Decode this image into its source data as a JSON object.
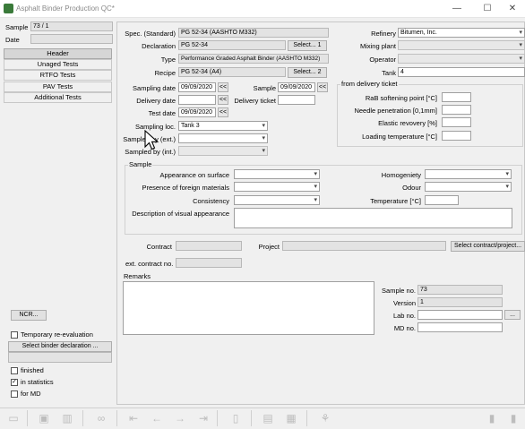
{
  "window": {
    "title": "Asphalt Binder Production QC*",
    "minimize": "—",
    "maximize": "☐",
    "close": "✕"
  },
  "sidebar": {
    "sample_label": "Sample",
    "sample_value": "73 / 1",
    "date_label": "Date",
    "date_value": "",
    "tabs": [
      {
        "label": "Header"
      },
      {
        "label": "Unaged Tests"
      },
      {
        "label": "RTFO Tests"
      },
      {
        "label": "PAV Tests"
      },
      {
        "label": "Additional Tests"
      }
    ],
    "ncr_button": "NCR...",
    "temporary_reevaluation": "Temporary re-evaluation",
    "select_binder_button": "Select binder declaration ...",
    "finished": "finished",
    "in_statistics": "in statistics",
    "for_md": "for MD",
    "temporary_checked": false,
    "finished_checked": false,
    "in_statistics_checked": true,
    "for_md_checked": false
  },
  "header": {
    "spec_label": "Spec. (Standard)",
    "spec_value": "PG 52-34 (AASHTO M332)",
    "declaration_label": "Declaration",
    "declaration_value": "PG 52-34",
    "select1_button": "Select... 1",
    "type_label": "Type",
    "type_value": "Performance Graded Asphalt Binder (AASHTO M332)",
    "recipe_label": "Recipe",
    "recipe_value": "PG 52-34 (A4)",
    "select2_button": "Select... 2",
    "sampling_date_label": "Sampling date",
    "sampling_date_value": "09/09/2020",
    "sample_label": "Sample",
    "sample_value": "09/09/2020",
    "delivery_date_label": "Delivery date",
    "delivery_date_value": "",
    "delivery_ticket_label": "Delivery ticket",
    "delivery_ticket_value": "",
    "test_date_label": "Test date",
    "test_date_value": "09/09/2020",
    "sampling_loc_label": "Sampling loc.",
    "sampling_loc_value": "Tank 3",
    "sampled_by_ext_label": "Sampled by (ext.)",
    "sampled_by_ext_value": "",
    "sampled_by_int_label": "Sampled by (int.)",
    "sampled_by_int_value": "",
    "refinery_label": "Refinery",
    "refinery_value": "Bitumen, Inc.",
    "mixing_plant_label": "Mixing plant",
    "mixing_plant_value": "",
    "operator_label": "Operator",
    "operator_value": "",
    "tank_label": "Tank",
    "tank_value": "4",
    "delivery_ticket_group": "from delivery ticket",
    "rab_label": "RaB softening point [°C]",
    "needle_label": "Needle penetration [0,1mm]",
    "elastic_label": "Elastic revovery [%]",
    "loading_label": "Loading temperature [°C]",
    "rab_value": "",
    "needle_value": "",
    "elastic_value": "",
    "loading_value": "",
    "date_picker_glyph": "<<"
  },
  "sample_group": {
    "title": "Sample",
    "appearance_label": "Appearance on surface",
    "appearance_value": "",
    "foreign_label": "Presence of foreign materials",
    "foreign_value": "",
    "consistency_label": "Consistency",
    "consistency_value": "",
    "description_label": "Description of visual appearance",
    "description_value": "",
    "homogeneity_label": "Homogeniety",
    "homogeneity_value": "",
    "odour_label": "Odour",
    "odour_value": "",
    "temperature_label": "Temperature [°C]",
    "temperature_value": ""
  },
  "contract": {
    "contract_label": "Contract",
    "contract_value": "",
    "project_label": "Project",
    "project_value": "",
    "select_contract_button": "Select contract/project...",
    "ext_contract_label": "ext. contract no.",
    "ext_contract_value": ""
  },
  "remarks": {
    "label": "Remarks",
    "value": "",
    "sample_no_label": "Sample no.",
    "sample_no_value": "73",
    "version_label": "Version",
    "version_value": "1",
    "lab_no_label": "Lab no.",
    "lab_no_value": "",
    "lab_no_button": "...",
    "md_no_label": "MD no.",
    "md_no_value": ""
  },
  "toolbar": {
    "icons": [
      "new-record-icon",
      "save-icon",
      "delete-icon",
      "binoculars-icon",
      "first-record-icon",
      "previous-record-icon",
      "next-record-icon",
      "last-record-icon",
      "door-icon",
      "report-icon",
      "print-icon",
      "stamp-icon",
      "exit-icon",
      "close-window-icon"
    ]
  },
  "colors": {
    "window_bg": "#f0f0f0",
    "field_bg": "#ffffff",
    "readonly_bg": "#e3e3e3"
  }
}
